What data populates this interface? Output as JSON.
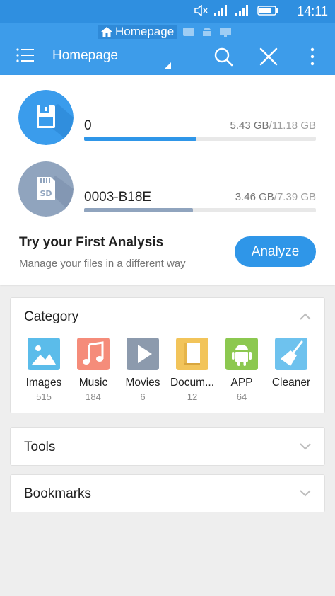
{
  "status_bar": {
    "time": "14:11"
  },
  "tabs": {
    "home_label": "Homepage"
  },
  "header": {
    "title": "Homepage"
  },
  "storages": [
    {
      "name": "0",
      "used": "5.43 GB",
      "total": "/11.18 GB",
      "progress": 0.486,
      "color": "#2f96e8"
    },
    {
      "name": "0003-B18E",
      "used": "3.46 GB",
      "total": "/7.39 GB",
      "progress": 0.468,
      "color": "#90a4be"
    }
  ],
  "analysis": {
    "title": "Try your First Analysis",
    "subtitle": "Manage your files in a different way",
    "button_label": "Analyze"
  },
  "category": {
    "title": "Category",
    "items": [
      {
        "label": "Images",
        "count": "515",
        "color": "#5bbcea",
        "icon": "image-icon"
      },
      {
        "label": "Music",
        "count": "184",
        "color": "#f58c7a",
        "icon": "music-icon"
      },
      {
        "label": "Movies",
        "count": "6",
        "color": "#8c9aad",
        "icon": "play-icon"
      },
      {
        "label": "Docum...",
        "count": "12",
        "color": "#f2c45a",
        "icon": "document-icon"
      },
      {
        "label": "APP",
        "count": "64",
        "color": "#8cc850",
        "icon": "android-icon"
      },
      {
        "label": "Cleaner",
        "count": "",
        "color": "#6ec2ee",
        "icon": "broom-icon"
      }
    ]
  },
  "tools": {
    "title": "Tools"
  },
  "bookmarks": {
    "title": "Bookmarks"
  }
}
